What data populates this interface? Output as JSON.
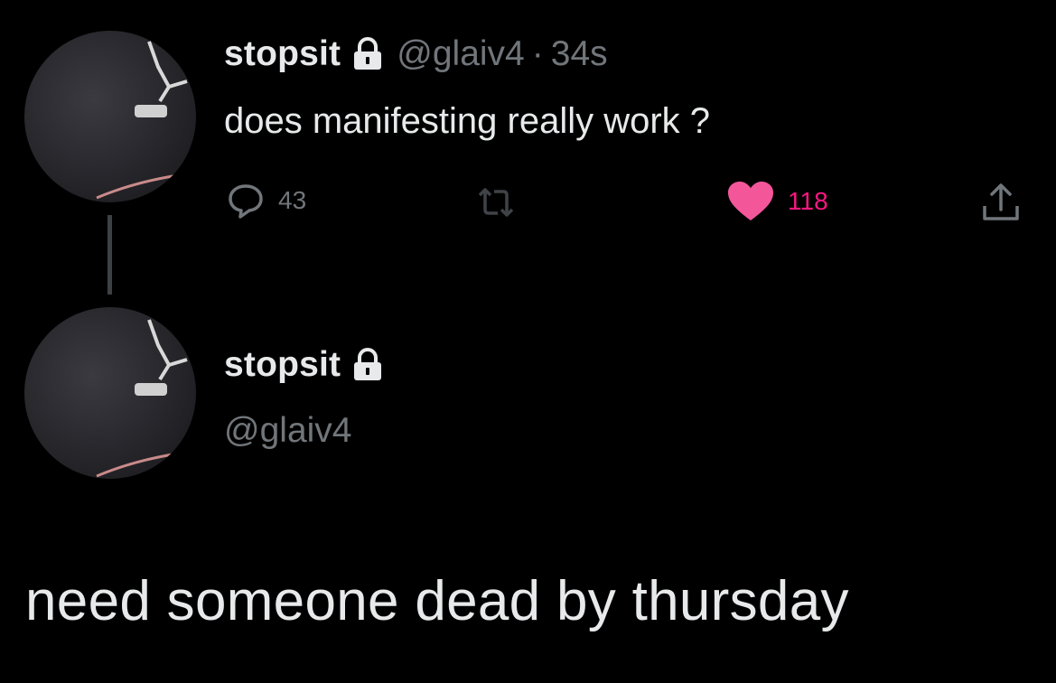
{
  "reply_tweet": {
    "display_name": "stopsit",
    "handle": "@glaiv4",
    "separator": "·",
    "time": "34s",
    "text": "does manifesting really work ?",
    "replies_count": "43",
    "likes_count": "118",
    "liked": true
  },
  "profile": {
    "display_name": "stopsit",
    "handle": "@glaiv4"
  },
  "caption": "need someone dead by thursday",
  "colors": {
    "background": "#000000",
    "text_primary": "#e7e9ea",
    "text_secondary": "#71767b",
    "like_pink": "#f91880",
    "thread_line": "#3e4144"
  },
  "icons": [
    "lock-icon",
    "reply-icon",
    "retweet-icon",
    "heart-icon",
    "share-icon"
  ]
}
